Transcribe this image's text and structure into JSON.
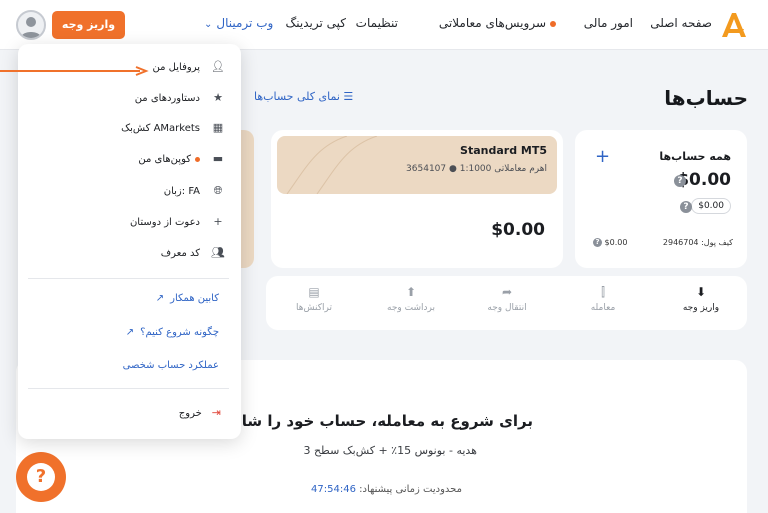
{
  "header": {
    "nav": [
      {
        "label": "صفحه اصلی"
      },
      {
        "label": "امور مالی"
      },
      {
        "label": "سرویس‌های معاملاتی"
      },
      {
        "label": "تنظیمات"
      },
      {
        "label": "کپی تریدینگ"
      }
    ],
    "terminal_label": "وب ترمینال",
    "deposit_label": "واریز وجه"
  },
  "page": {
    "title": "حساب‌ها",
    "overview_label": "نمای کلی حساب‌ها"
  },
  "all_accounts": {
    "title": "همه حساب‌ها",
    "balance": "$0.00",
    "pill": "$0.00",
    "wallet_label": "کیف پول: 2946704",
    "wallet_balance": "$0.00"
  },
  "mt5": {
    "title": "Standard MT5",
    "subtitle": "3654107 ● اهرم معاملاتی 1:1000",
    "balance": "$0.00"
  },
  "actions": [
    {
      "label": "واریز وجه",
      "icon": "download-icon",
      "active": true
    },
    {
      "label": "معامله",
      "icon": "trade-icon",
      "active": false
    },
    {
      "label": "انتقال وجه",
      "icon": "transfer-icon",
      "active": false
    },
    {
      "label": "برداشت وجه",
      "icon": "upload-icon",
      "active": false
    },
    {
      "label": "تراکنش‌ها",
      "icon": "receipt-icon",
      "active": false
    }
  ],
  "promo": {
    "title": "برای شروع به معامله، حساب خود را شارژ کنید",
    "subtitle": "هدیه - بونوس 15٪ + کش‌بک سطح 3",
    "timer_label": "محدودیت زمانی پیشنهاد:",
    "timer_value": "47:54:46"
  },
  "menu": {
    "items": [
      {
        "label": "پروفایل من",
        "icon": "user-icon"
      },
      {
        "label": "دستاوردهای من",
        "icon": "star-icon"
      },
      {
        "label": "کش‌بک AMarkets",
        "icon": "gift-icon"
      },
      {
        "label": "کوپن‌های من",
        "icon": "ticket-icon",
        "dot": true
      },
      {
        "label": "زبان: FA",
        "icon": "globe-icon"
      },
      {
        "label": "دعوت از دوستان",
        "icon": "add-user-icon"
      },
      {
        "label": "کد معرف",
        "icon": "users-icon"
      }
    ],
    "links": [
      {
        "label": "کابین همکار"
      },
      {
        "label": "چگونه شروع کنیم؟"
      },
      {
        "label": "عملکرد حساب شخصی"
      }
    ],
    "logout_label": "خروج"
  },
  "colors": {
    "accent": "#f0712b",
    "link": "#2f64c5",
    "card_tint": "#ecd9c3",
    "danger": "#e0463a"
  }
}
